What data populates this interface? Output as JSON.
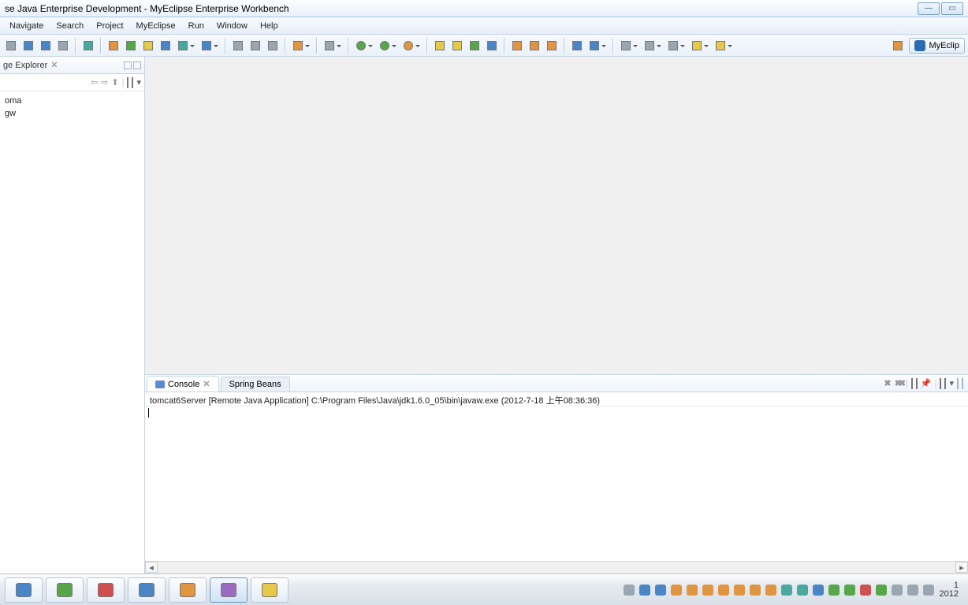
{
  "window": {
    "title": "se Java Enterprise Development - MyEclipse Enterprise Workbench"
  },
  "menu": [
    "Navigate",
    "Search",
    "Project",
    "MyEclipse",
    "Run",
    "Window",
    "Help"
  ],
  "toolbar_groups": [
    [
      {
        "n": "new-icon",
        "c": "c-gray",
        "d": false
      },
      {
        "n": "save-icon",
        "c": "c-blue",
        "d": false
      },
      {
        "n": "saveall-icon",
        "c": "c-blue",
        "d": false
      },
      {
        "n": "print-icon",
        "c": "c-gray",
        "d": false
      }
    ],
    [
      {
        "n": "build-icon",
        "c": "c-teal",
        "d": false
      }
    ],
    [
      {
        "n": "struts-icon",
        "c": "c-orange",
        "d": false
      },
      {
        "n": "spring-icon",
        "c": "c-green",
        "d": false
      },
      {
        "n": "hibernate-icon",
        "c": "c-yellow",
        "d": false
      },
      {
        "n": "jsf-icon",
        "c": "c-blue",
        "d": false
      },
      {
        "n": "deploy-icon",
        "c": "c-teal",
        "d": true
      },
      {
        "n": "browser-icon",
        "c": "c-blue",
        "d": true
      }
    ],
    [
      {
        "n": "tool1-icon",
        "c": "c-gray",
        "d": false
      },
      {
        "n": "tool2-icon",
        "c": "c-gray",
        "d": false
      },
      {
        "n": "tool3-icon",
        "c": "c-gray",
        "d": false
      }
    ],
    [
      {
        "n": "image-icon",
        "c": "c-orange",
        "d": true
      }
    ],
    [
      {
        "n": "camera-icon",
        "c": "c-gray",
        "d": true
      }
    ],
    [
      {
        "n": "debug-icon",
        "c": "c-green",
        "d": true
      },
      {
        "n": "run-icon",
        "c": "c-green",
        "d": true
      },
      {
        "n": "runext-icon",
        "c": "c-orange",
        "d": true
      }
    ],
    [
      {
        "n": "pkg1-icon",
        "c": "c-yellow",
        "d": false
      },
      {
        "n": "pkg2-icon",
        "c": "c-yellow",
        "d": false
      },
      {
        "n": "pkg3-icon",
        "c": "c-green",
        "d": false
      },
      {
        "n": "pkg4-icon",
        "c": "c-blue",
        "d": false
      }
    ],
    [
      {
        "n": "folder1-icon",
        "c": "c-orange",
        "d": false
      },
      {
        "n": "pencil-icon",
        "c": "c-orange",
        "d": false
      },
      {
        "n": "search2-icon",
        "c": "c-orange",
        "d": false
      }
    ],
    [
      {
        "n": "align1-icon",
        "c": "c-blue",
        "d": false
      },
      {
        "n": "align2-icon",
        "c": "c-blue",
        "d": true
      }
    ],
    [
      {
        "n": "nav1-icon",
        "c": "c-gray",
        "d": true
      },
      {
        "n": "nav2-icon",
        "c": "c-gray",
        "d": true
      },
      {
        "n": "nav3-icon",
        "c": "c-gray",
        "d": true
      },
      {
        "n": "back-icon",
        "c": "c-yellow",
        "d": true
      },
      {
        "n": "fwd-icon",
        "c": "c-yellow",
        "d": true
      }
    ]
  ],
  "perspective": {
    "label": "MyEclip"
  },
  "explorer": {
    "title": "ge Explorer",
    "items": [
      "oma",
      "gw"
    ]
  },
  "bottom": {
    "tabs": [
      {
        "label": "Console",
        "selected": true
      },
      {
        "label": "Spring Beans",
        "selected": false
      }
    ],
    "info": "tomcat6Server [Remote Java Application] C:\\Program Files\\Java\\jdk1.6.0_05\\bin\\javaw.exe (2012-7-18 上午08:36:36)",
    "actions": [
      "terminate",
      "remove",
      "remove-all",
      "clear",
      "lock",
      "pin",
      "display",
      "min",
      "max"
    ]
  },
  "taskbar": {
    "buttons": [
      {
        "n": "ie-icon",
        "c": "c-blue"
      },
      {
        "n": "browser-icon",
        "c": "c-green"
      },
      {
        "n": "toolbox-icon",
        "c": "c-red"
      },
      {
        "n": "word-icon",
        "c": "c-blue"
      },
      {
        "n": "notepad-icon",
        "c": "c-orange"
      },
      {
        "n": "eclipse-icon",
        "c": "c-purple"
      },
      {
        "n": "explorer-icon",
        "c": "c-yellow"
      }
    ],
    "tray": [
      "keyboard-icon",
      "safe-icon",
      "qq1-icon",
      "qq2-icon",
      "qq3-icon",
      "qq4-icon",
      "qq5-icon",
      "qq6-icon",
      "qq7-icon",
      "chat-icon",
      "cloud-icon",
      "av-icon",
      "shield-icon",
      "music-icon",
      "kav-icon",
      "net-icon",
      "usb-icon",
      "flag-icon",
      "battery-icon",
      "volume-icon"
    ],
    "time_top": "1",
    "time_bottom": "2012"
  }
}
